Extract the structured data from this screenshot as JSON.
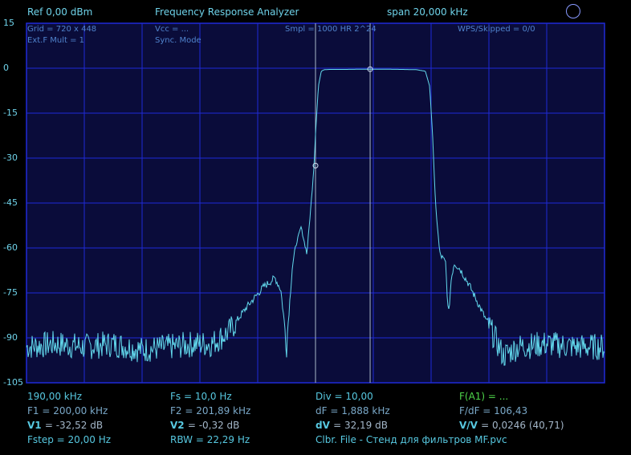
{
  "header": {
    "ref": "Ref  0,00 dBm",
    "title": "Frequency Response Analyzer",
    "span": "span 20,000 kHz"
  },
  "info": {
    "grid": "Grid = 720 x 448",
    "ext_mult": "Ext.F Mult = 1",
    "vcc": "Vcc = ...",
    "sync": "Sync. Mode",
    "smpl": "Smpl = 1000 HR 2^24",
    "wps": "WPS/Skipped  = 0/0"
  },
  "colors": {
    "background": "#000000",
    "plot_bg": "#0a0c3a",
    "grid": "#1f2ad8",
    "trace": "#62d8ec",
    "text": "#57c8e0",
    "green": "#4ed64a"
  },
  "readouts": {
    "col1": [
      "190,00 kHz",
      "F1 = 200,00 kHz",
      "V1",
      "= -32,52 dB",
      "Fstep = 20,00 Hz"
    ],
    "col2": [
      "Fs = 10,0 Hz",
      "F2 = 201,89 kHz",
      "V2",
      "= -0,32 dB",
      "RBW = 22,29 Hz"
    ],
    "col3": [
      "Div = 10,00",
      "dF = 1,888 kHz",
      "dV",
      "= 32,19 dB",
      "Clbr. File - Стенд для фильтров MF.pvc"
    ],
    "col4": [
      "F(A1) = ...",
      "F/dF = 106,43",
      "V/V",
      "= 0,0246 (40,71)"
    ]
  },
  "chart_data": {
    "type": "line",
    "title": "Frequency Response Analyzer",
    "xlabel": "",
    "ylabel": "",
    "y_tick_labels": [
      "15",
      "0",
      "-15",
      "-30",
      "-45",
      "-60",
      "-75",
      "-90",
      "-105"
    ],
    "ylim": [
      -105,
      15
    ],
    "xlim_khz": [
      190,
      210
    ],
    "x_divisions": 10,
    "grid": true,
    "markers": [
      {
        "name": "F1",
        "x_khz": 200.0,
        "y_db": -32.52
      },
      {
        "name": "F2",
        "x_khz": 201.89,
        "y_db": -0.32
      }
    ],
    "series": [
      {
        "x_khz": [
          190.0,
          191.0,
          192.0,
          193.0,
          194.0,
          195.0,
          195.8,
          196.4,
          197.0,
          197.6,
          198.2,
          198.6,
          198.8,
          199.0,
          199.2,
          199.35,
          199.5,
          199.7,
          199.85,
          199.95,
          200.0,
          200.1,
          200.2,
          200.3,
          200.5,
          201.0,
          201.5,
          201.89,
          202.5,
          203.0,
          203.5,
          203.8,
          203.95,
          204.05,
          204.15,
          204.3,
          204.5,
          204.6,
          204.7,
          204.8,
          205.0,
          205.3,
          205.7,
          206.1,
          206.5,
          207.0,
          208.0,
          209.0,
          210.0
        ],
        "y_db": [
          -93,
          -92,
          -93,
          -92,
          -94,
          -93,
          -92,
          -92,
          -88,
          -80,
          -73,
          -70,
          -74,
          -92,
          -66,
          -58,
          -53,
          -62,
          -45,
          -32.52,
          -22,
          -6,
          -1,
          -0.5,
          -0.4,
          -0.4,
          -0.35,
          -0.32,
          -0.35,
          -0.4,
          -0.5,
          -1,
          -6,
          -22,
          -45,
          -62,
          -65,
          -83,
          -70,
          -65,
          -67,
          -72,
          -80,
          -88,
          -96,
          -93,
          -92,
          -93,
          -93
        ]
      }
    ]
  }
}
